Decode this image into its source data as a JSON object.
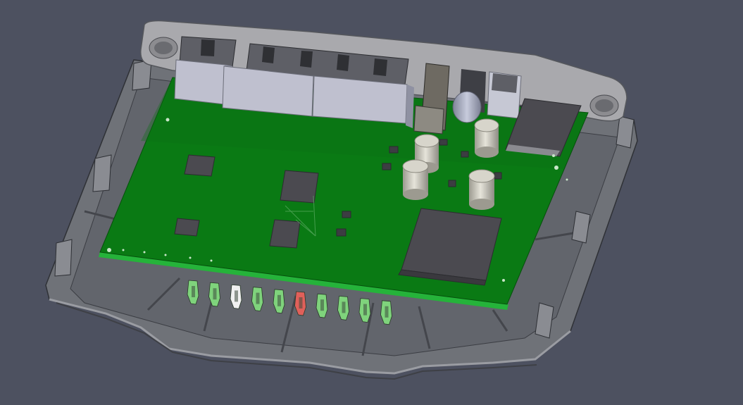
{
  "viewport": {
    "background": "#4d5160",
    "subject": "cad-model-pcb-in-enclosure"
  },
  "colors": {
    "pcb": "#0a7a14",
    "pcb_edge": "#25b33a",
    "housing": "#6f7278",
    "housing_dark": "#555860",
    "bracket": "#a9a9ad",
    "connector": "#bfc0cf",
    "chip": "#4b4a50",
    "led_green": "#7fd37c",
    "led_white": "#f0f0f0",
    "led_red": "#e0605a",
    "electrolytic_cap": "#c8c6bc"
  },
  "leds": [
    "green",
    "green",
    "white",
    "green",
    "green",
    "red",
    "green",
    "green",
    "green",
    "green"
  ]
}
